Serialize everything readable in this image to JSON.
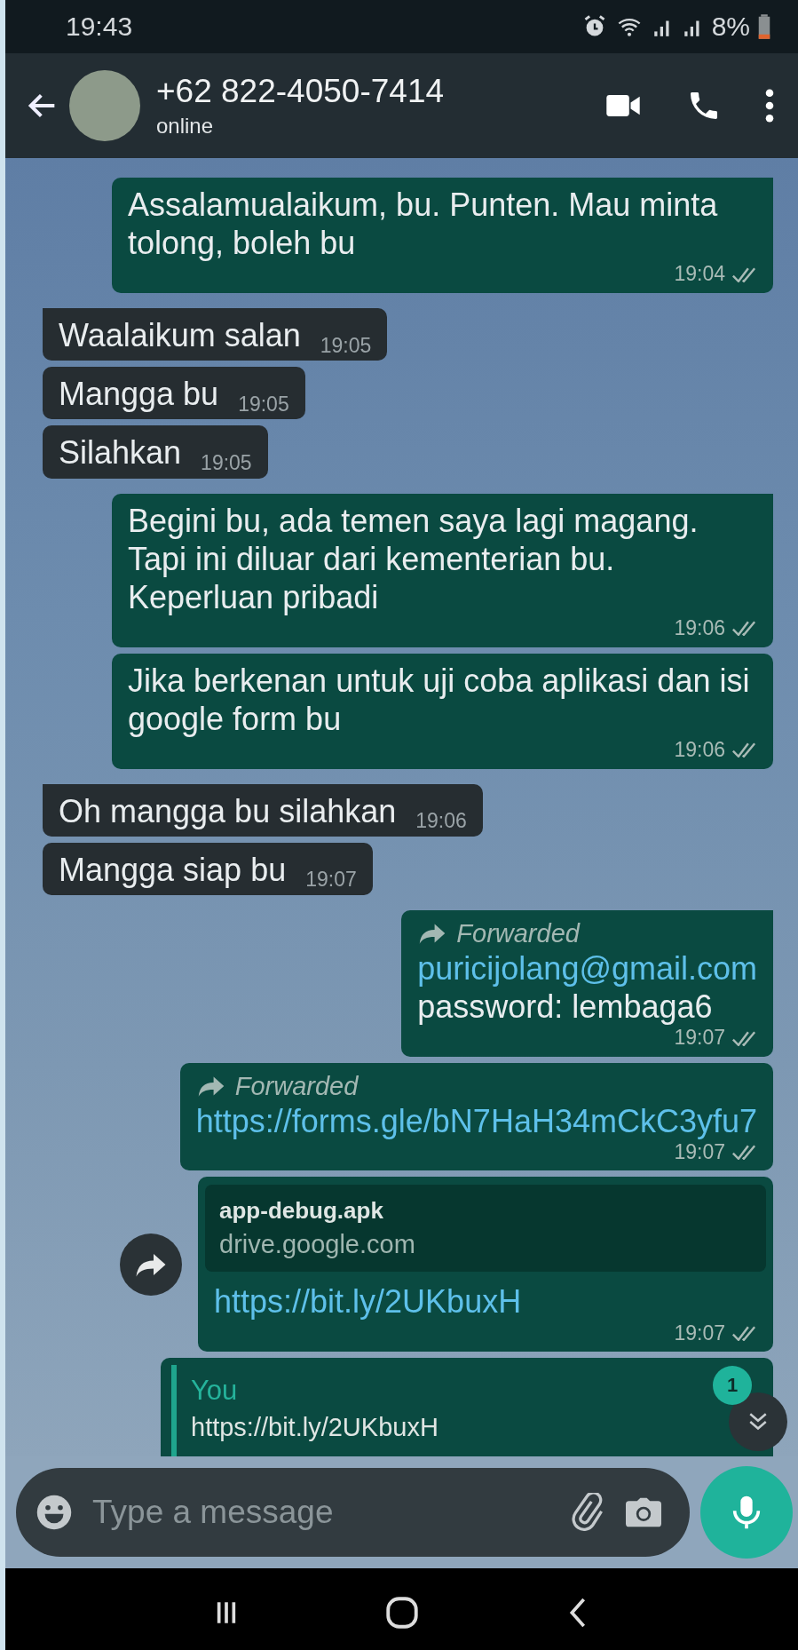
{
  "status_bar": {
    "time": "19:43",
    "battery": "8%"
  },
  "header": {
    "contact": "+62 822-4050-7414",
    "presence": "online"
  },
  "messages": [
    {
      "kind": "outgoing",
      "text": "Assalamualaikum, bu. Punten. Mau minta tolong, boleh bu",
      "time": "19:04",
      "delivered": true,
      "tail": true
    },
    {
      "kind": "incoming",
      "text": "Waalaikum salan",
      "time": "19:05",
      "tail": true
    },
    {
      "kind": "incoming",
      "text": "Mangga bu",
      "time": "19:05",
      "tail": false
    },
    {
      "kind": "incoming",
      "text": "Silahkan",
      "time": "19:05",
      "tail": false
    },
    {
      "kind": "outgoing",
      "text": "Begini bu, ada temen saya lagi magang. Tapi ini diluar dari kementerian bu. Keperluan pribadi",
      "time": "19:06",
      "delivered": true,
      "tail": true
    },
    {
      "kind": "outgoing",
      "text": "Jika berkenan untuk uji coba aplikasi dan isi google form bu",
      "time": "19:06",
      "delivered": true,
      "tail": false
    },
    {
      "kind": "incoming",
      "text": "Oh mangga bu silahkan",
      "time": "19:06",
      "tail": true
    },
    {
      "kind": "incoming",
      "text": "Mangga siap bu",
      "time": "19:07",
      "tail": false
    },
    {
      "kind": "outgoing",
      "forwarded": "Forwarded",
      "link": "puricijolang@gmail.com",
      "text": "password: lembaga6",
      "time": "19:07",
      "delivered": true,
      "tail": true
    },
    {
      "kind": "outgoing",
      "forwarded": "Forwarded",
      "link": "https://forms.gle/bN7HaH34mCkC3yfu7",
      "time": "19:07",
      "delivered": true,
      "tail": false
    },
    {
      "kind": "outgoing",
      "preview": {
        "title": "app-debug.apk",
        "domain": "drive.google.com"
      },
      "link": "https://bit.ly/2UKbuxH",
      "time": "19:07",
      "delivered": true,
      "tail": false,
      "share_button": true
    },
    {
      "kind": "outgoing",
      "quote": {
        "author": "You",
        "text": "https://bit.ly/2UKbuxH"
      },
      "tail": false
    }
  ],
  "scroll_badge": "1",
  "composer": {
    "placeholder": "Type a message"
  }
}
